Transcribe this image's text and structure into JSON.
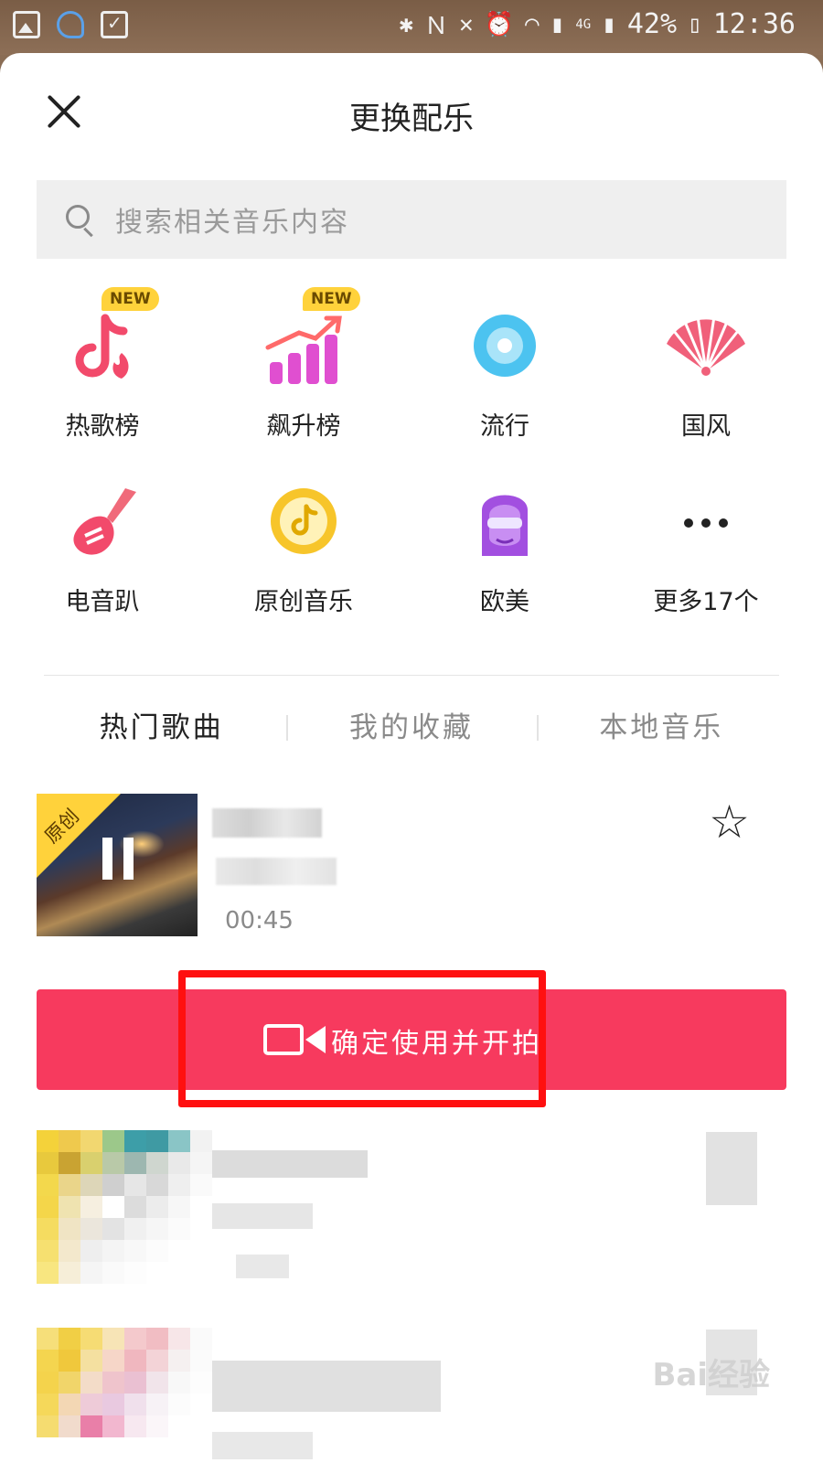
{
  "status_bar": {
    "battery": "42%",
    "time": "12:36",
    "network": "4G"
  },
  "header": {
    "title": "更换配乐"
  },
  "search": {
    "placeholder": "搜索相关音乐内容"
  },
  "categories": [
    {
      "label": "热歌榜",
      "badge": "NEW",
      "icon": "tiktok-flame-icon"
    },
    {
      "label": "飙升榜",
      "badge": "NEW",
      "icon": "rising-chart-icon"
    },
    {
      "label": "流行",
      "icon": "disc-icon"
    },
    {
      "label": "国风",
      "icon": "folding-fan-icon"
    },
    {
      "label": "电音趴",
      "icon": "guitar-icon"
    },
    {
      "label": "原创音乐",
      "icon": "music-note-circle-icon"
    },
    {
      "label": "欧美",
      "icon": "sunglasses-person-icon"
    },
    {
      "label": "更多17个",
      "icon": "more-dots-icon"
    }
  ],
  "tabs": [
    {
      "label": "热门歌曲",
      "active": true
    },
    {
      "label": "我的收藏",
      "active": false
    },
    {
      "label": "本地音乐",
      "active": false
    }
  ],
  "current_song": {
    "corner_badge": "原创",
    "duration": "00:45",
    "playing": true
  },
  "confirm_button": {
    "label": "确定使用并开拍"
  },
  "watermark": "Bai经验",
  "colors": {
    "accent": "#f73a5e",
    "badge_yellow": "#ffd23b",
    "highlight_box": "#ff1010"
  }
}
